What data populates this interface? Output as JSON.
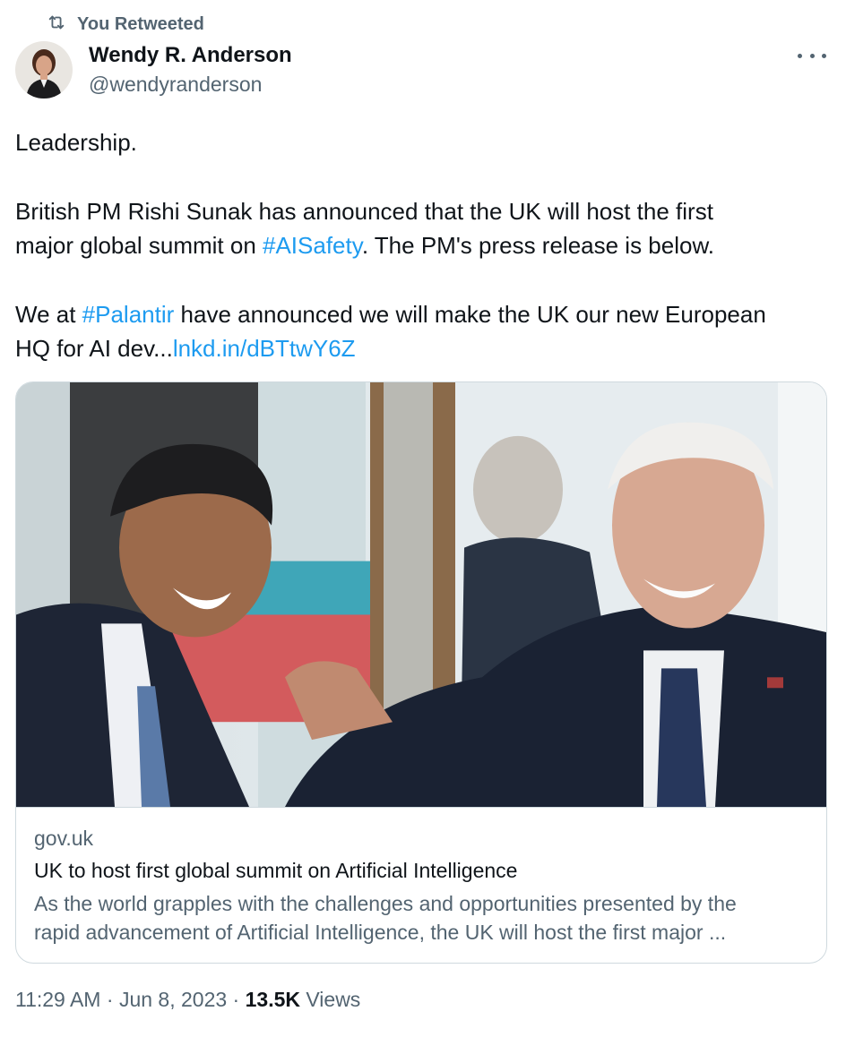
{
  "retweet": {
    "label": "You Retweeted",
    "icon": "retweet-icon"
  },
  "author": {
    "name": "Wendy R. Anderson",
    "handle": "@wendyranderson",
    "avatar_icon": "avatar-photo"
  },
  "more_icon": "more-options-icon",
  "tweet": {
    "line1": "Leadership.",
    "line2": "British PM Rishi Sunak has announced that the UK will host the first",
    "line3_pre": "major global summit on ",
    "line3_tag": "#AISafety",
    "line3_post": ". The PM's press release is below.",
    "line4_pre": "We at ",
    "line4_tag": "#Palantir",
    "line4_post": " have announced we will make the UK our new European",
    "line5_pre": "HQ for AI dev...",
    "line5_link": "lnkd.in/dBTtwY6Z"
  },
  "card": {
    "domain": "gov.uk",
    "title": "UK to host first global summit on Artificial Intelligence",
    "desc_line1": "As the world grapples with the challenges and opportunities presented by the",
    "desc_line2": "rapid advancement of Artificial Intelligence, the UK will host the first major ..."
  },
  "meta": {
    "time": "11:29 AM",
    "sep1": " · ",
    "date": "Jun 8, 2023",
    "sep2": " · ",
    "views_count": "13.5K",
    "views_label": " Views"
  },
  "colors": {
    "link": "#1d9bf0",
    "secondary": "#536471",
    "primary": "#0f1419",
    "border": "#cfd9de"
  }
}
